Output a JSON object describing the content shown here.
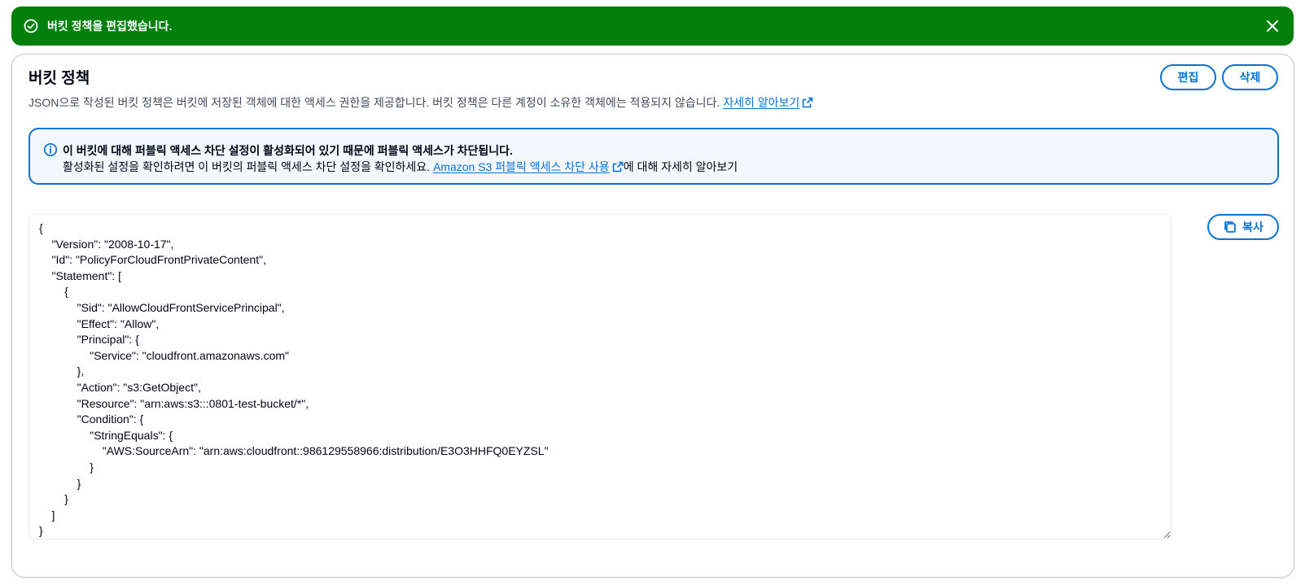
{
  "flash": {
    "message": "버킷 정책을 편집했습니다.",
    "icon": "check-circle-icon",
    "close_icon": "close-icon",
    "color": "#037f0c"
  },
  "section": {
    "title": "버킷 정책",
    "description": "JSON으로 작성된 버킷 정책은 버킷에 저장된 객체에 대한 액세스 권한을 제공합니다. 버킷 정책은 다른 계정이 소유한 객체에는 적용되지 않습니다. ",
    "learn_more_link": "자세히 알아보기",
    "edit_label": "편집",
    "delete_label": "삭제"
  },
  "alert": {
    "title": "이 버킷에 대해 퍼블릭 액세스 차단 설정이 활성화되어 있기 때문에 퍼블릭 액세스가 차단됩니다.",
    "body_prefix": "활성화된 설정을 확인하려면 이 버킷의 퍼블릭 액세스 차단 설정을 확인하세요. ",
    "link_text": "Amazon S3 퍼블릭 액세스 차단 사용",
    "body_suffix": "에 대해 자세히 알아보기",
    "color": "#0972d3"
  },
  "policy": {
    "copy_label": "복사",
    "json_text": "{\n    \"Version\": \"2008-10-17\",\n    \"Id\": \"PolicyForCloudFrontPrivateContent\",\n    \"Statement\": [\n        {\n            \"Sid\": \"AllowCloudFrontServicePrincipal\",\n            \"Effect\": \"Allow\",\n            \"Principal\": {\n                \"Service\": \"cloudfront.amazonaws.com\"\n            },\n            \"Action\": \"s3:GetObject\",\n            \"Resource\": \"arn:aws:s3:::0801-test-bucket/*\",\n            \"Condition\": {\n                \"StringEquals\": {\n                    \"AWS:SourceArn\": \"arn:aws:cloudfront::986129558966:distribution/E3O3HHFQ0EYZSL\"\n                }\n            }\n        }\n    ]\n}"
  }
}
